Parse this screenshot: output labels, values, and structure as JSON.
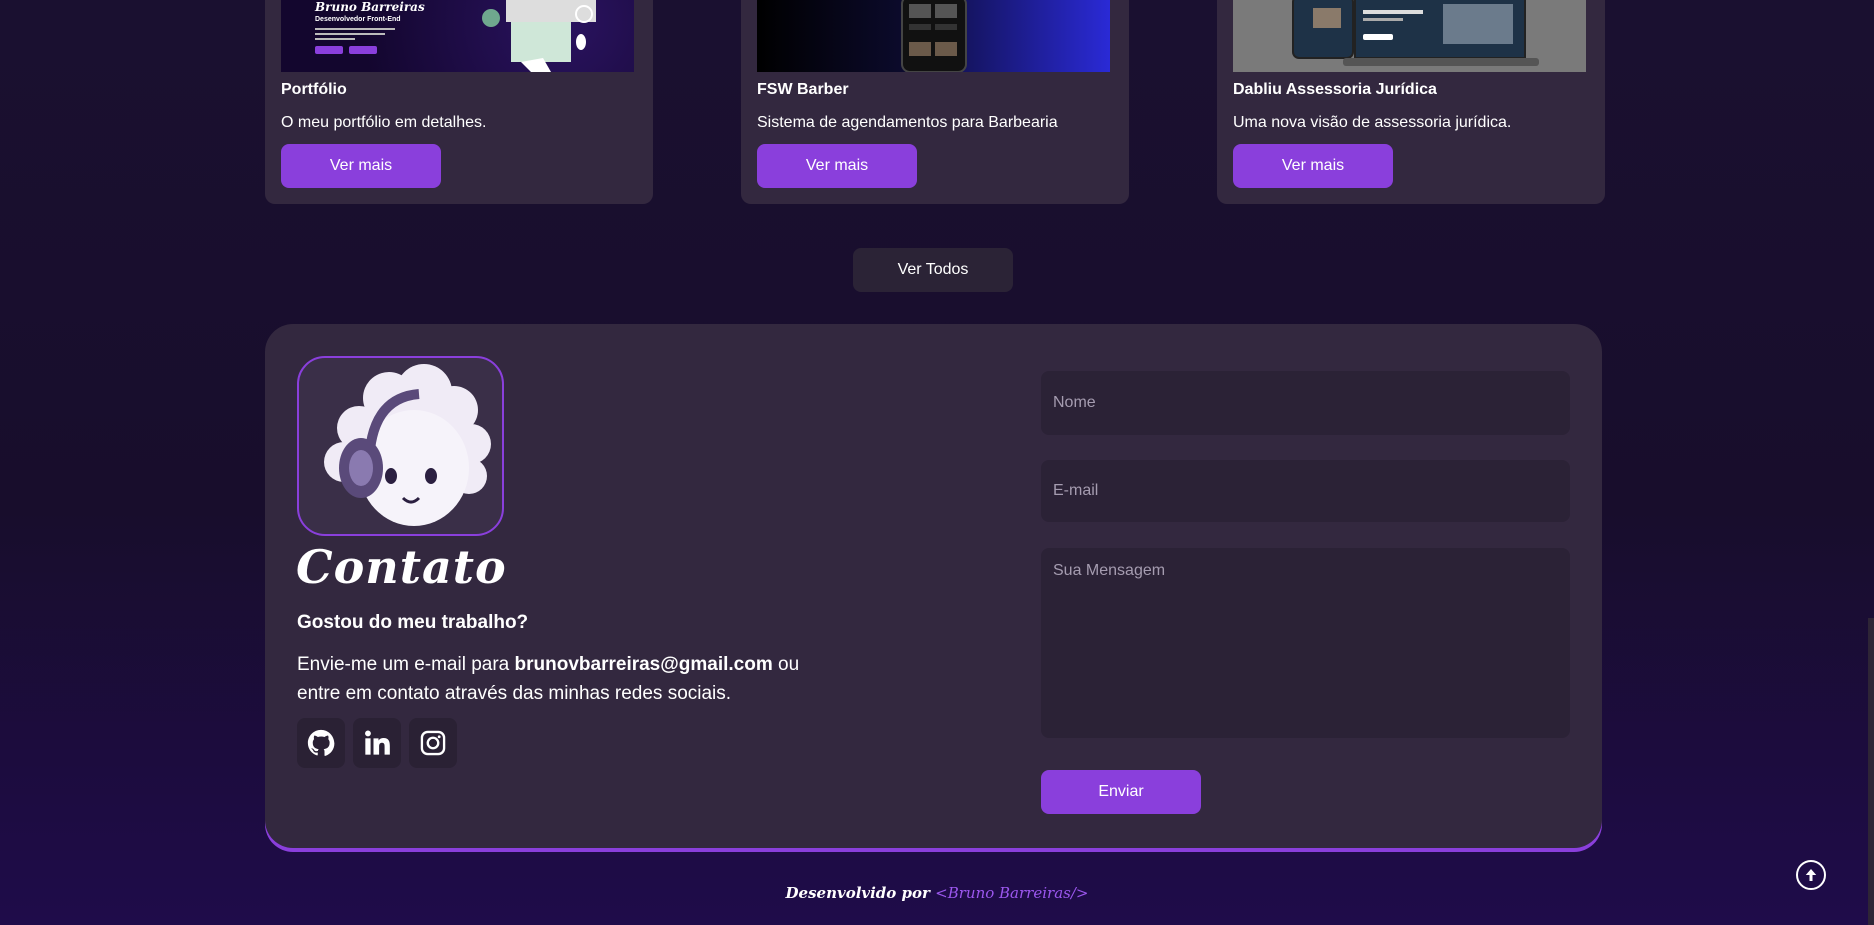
{
  "projects": {
    "cards": [
      {
        "title": "Portfólio",
        "description": "O meu portfólio em detalhes.",
        "button": "Ver mais",
        "thumb_text": {
          "name": "Bruno Barreiras",
          "role": "Desenvolvedor Front-End"
        }
      },
      {
        "title": "FSW Barber",
        "description": "Sistema de agendamentos para Barbearia",
        "button": "Ver mais"
      },
      {
        "title": "Dabliu Assessoria Jurídica",
        "description": "Uma nova visão de assessoria jurídica.",
        "button": "Ver mais"
      }
    ],
    "view_all": "Ver Todos"
  },
  "contact": {
    "title": "Contato",
    "subtitle": "Gostou do meu trabalho?",
    "text_before": "Envie-me um e-mail para ",
    "email": "brunovbarreiras@gmail.com",
    "text_after": " ou entre em contato através das minhas redes sociais.",
    "socials": [
      {
        "icon": "github-icon"
      },
      {
        "icon": "linkedin-icon"
      },
      {
        "icon": "instagram-icon"
      }
    ],
    "form": {
      "name_placeholder": "Nome",
      "email_placeholder": "E-mail",
      "message_placeholder": "Sua Mensagem",
      "submit": "Enviar"
    }
  },
  "footer": {
    "prefix": "Desenvolvido por ",
    "brand": "<Bruno Barreiras/>"
  },
  "colors": {
    "accent": "#8a3fdc",
    "card": "#33283f",
    "bg": "#180d2c"
  }
}
